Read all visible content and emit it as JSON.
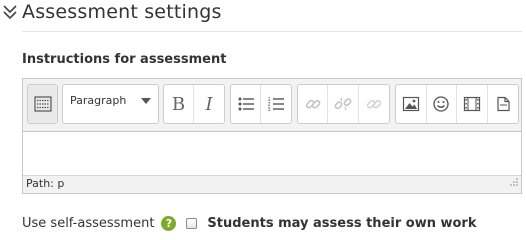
{
  "section": {
    "title": "Assessment settings",
    "toggle_icon": "chevron-double-down-icon"
  },
  "instructions": {
    "label": "Instructions for assessment"
  },
  "editor": {
    "block_format": "Paragraph",
    "status_path": "Path: p",
    "toolbar": {
      "toggle": "toolbar-toggle-icon",
      "bold": "B",
      "italic": "I",
      "bullet_list": "unordered-list-icon",
      "numbered_list": "ordered-list-icon",
      "link": "link-icon",
      "unlink": "unlink-icon",
      "anchor": "anchor-link-icon",
      "image": "image-icon",
      "emoticon": "emoticon-icon",
      "media": "media-icon",
      "manage_files": "manage-files-icon"
    }
  },
  "self_assessment": {
    "label": "Use self-assessment",
    "help": "?",
    "checkbox_label": "Students may assess their own work",
    "checked": false
  },
  "colors": {
    "help_badge": "#7cab2a",
    "toolbar_bg": "#f2f2f2",
    "border": "#c8c8c8"
  }
}
